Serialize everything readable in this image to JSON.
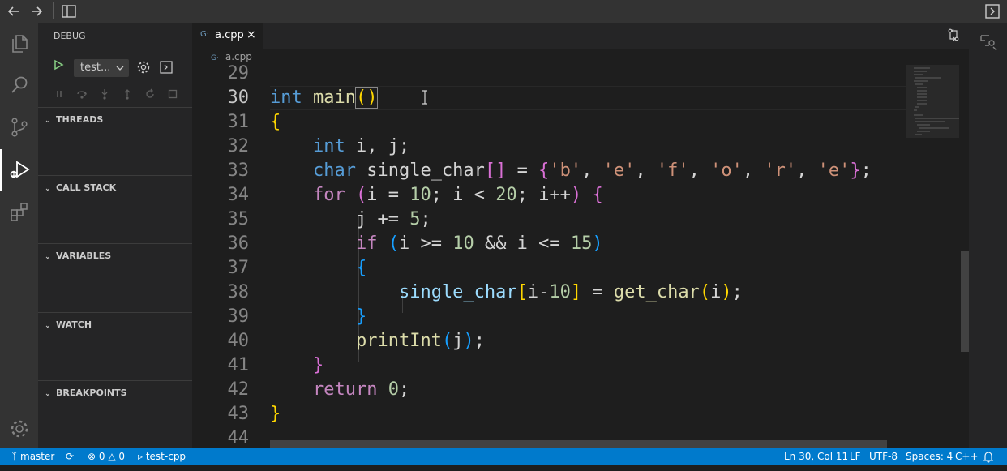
{
  "nav": {
    "back_icon": "arrow-left-icon",
    "forward_icon": "arrow-right-icon",
    "layout_icon": "split-layout-icon",
    "panel_icon": "toggle-panel-icon"
  },
  "activity": {
    "items": [
      "files-icon",
      "search-icon",
      "source-control-icon",
      "run-debug-icon",
      "extensions-icon"
    ],
    "manage": "gear-icon"
  },
  "sidebar": {
    "title": "DEBUG",
    "config_label": "test...",
    "sections": [
      "THREADS",
      "CALL STACK",
      "VARIABLES",
      "WATCH",
      "BREAKPOINTS"
    ]
  },
  "editor": {
    "tab_label": "a.cpp",
    "breadcrumb": "a.cpp",
    "lines": [
      {
        "n": "29"
      },
      {
        "n": "30"
      },
      {
        "n": "31"
      },
      {
        "n": "32"
      },
      {
        "n": "33"
      },
      {
        "n": "34"
      },
      {
        "n": "35"
      },
      {
        "n": "36"
      },
      {
        "n": "37"
      },
      {
        "n": "38"
      },
      {
        "n": "39"
      },
      {
        "n": "40"
      },
      {
        "n": "41"
      },
      {
        "n": "42"
      },
      {
        "n": "43"
      },
      {
        "n": "44"
      }
    ],
    "code": {
      "l30": {
        "kw": "int",
        "fn": "main",
        "p": "()"
      },
      "l31": "{",
      "l32": {
        "kw": "int",
        "rest": " i, j;"
      },
      "l33": {
        "kw": "char",
        "name": " single_char",
        "idx": "[]",
        "eq": " = ",
        "ob": "{",
        "c1": "'b'",
        "c2": "'e'",
        "c3": "'f'",
        "c4": "'o'",
        "c5": "'r'",
        "c6": "'e'",
        "cb": "}",
        "sc": ";",
        "comma": ", "
      },
      "l34": {
        "kw": "for",
        "op": " (",
        "a": "i = ",
        "n1": "10",
        "b": "; i < ",
        "n2": "20",
        "c": "; i++",
        "cp": ")",
        "sp": " ",
        "ob": "{"
      },
      "l35": {
        "a": "j += ",
        "n": "5",
        "sc": ";"
      },
      "l36": {
        "kw": "if",
        "op": " (",
        "a": "i >= ",
        "n1": "10",
        "b": " && i <= ",
        "n2": "15",
        "cp": ")"
      },
      "l37": "{",
      "l38": {
        "name": "single_char",
        "ob": "[",
        "a": "i-",
        "n": "10",
        "cb": "]",
        "eq": " = ",
        "fn": "get_char",
        "op": "(",
        "i": "i",
        "cp": ")",
        "sc": ";"
      },
      "l39": "}",
      "l40": {
        "fn": "printInt",
        "op": "(",
        "j": "j",
        "cp": ")",
        "sc": ";"
      },
      "l41": "}",
      "l42": {
        "kw": "return",
        "sp": " ",
        "n": "0",
        "sc": ";"
      },
      "l43": "}"
    }
  },
  "status": {
    "branch": "master",
    "errors": "0",
    "warnings": "0",
    "launch": "test-cpp",
    "position": "Ln 30, Col 11",
    "eol": "LF",
    "encoding": "UTF-8",
    "indent": "Spaces: 4",
    "language": "C++"
  },
  "colors": {
    "status_bar": "#007acc",
    "editor_bg": "#1e1e1e",
    "sidebar_bg": "#252526",
    "activity_bg": "#333333"
  }
}
